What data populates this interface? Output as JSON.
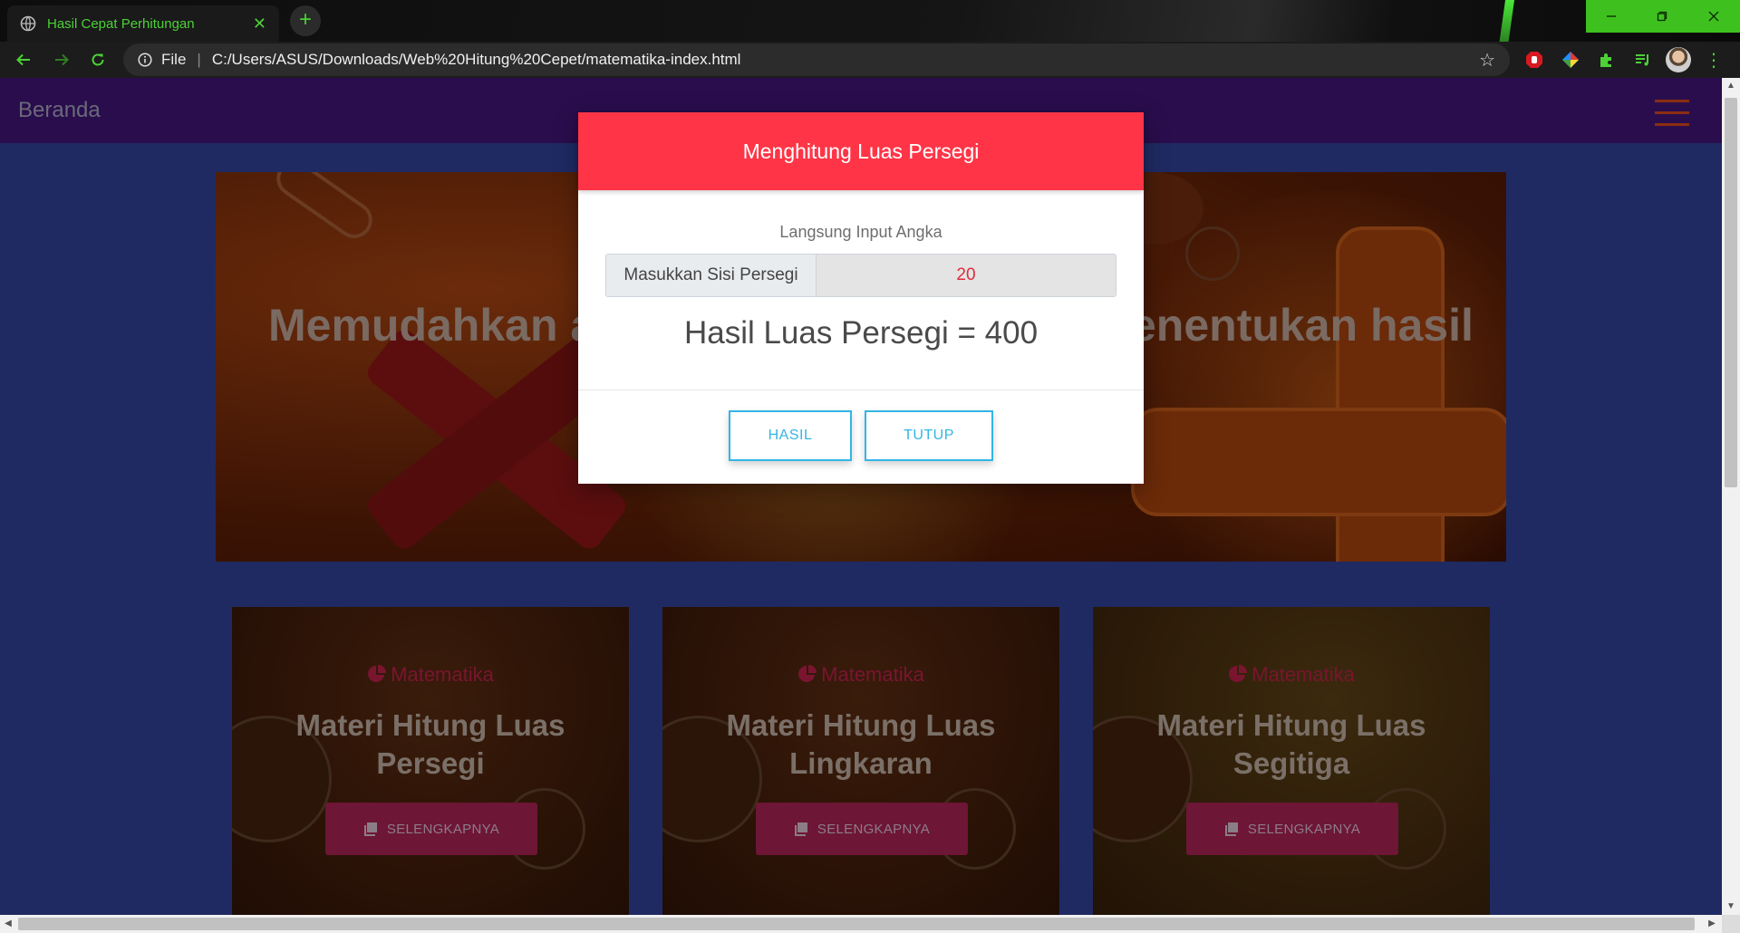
{
  "browser": {
    "tab_title": "Hasil Cepat Perhitungan",
    "tab_close": "✕",
    "new_tab": "+",
    "address": {
      "scheme": "File",
      "separator": "|",
      "url": "C:/Users/ASUS/Downloads/Web%20Hitung%20Cepet/matematika-index.html"
    },
    "accent_color": "#4cd137"
  },
  "navbar": {
    "brand": "Beranda"
  },
  "hero": {
    "text_left": "Memudahkan a",
    "text_right": "enentukan hasil"
  },
  "cards": [
    {
      "category": "Matematika",
      "title_line1": "Materi Hitung Luas",
      "title_line2": "Persegi",
      "button": "SELENGKAPNYA"
    },
    {
      "category": "Matematika",
      "title_line1": "Materi Hitung Luas",
      "title_line2": "Lingkaran",
      "button": "SELENGKAPNYA"
    },
    {
      "category": "Matematika",
      "title_line1": "Materi Hitung Luas",
      "title_line2": "Segitiga",
      "button": "SELENGKAPNYA"
    }
  ],
  "modal": {
    "title": "Menghitung Luas Persegi",
    "hint": "Langsung Input Angka",
    "input_prefix": "Masukkan Sisi Persegi",
    "input_value": "20",
    "result": "Hasil Luas Persegi = 400",
    "btn_hasil": "HASIL",
    "btn_tutup": "TUTUP",
    "header_color": "#ff3547",
    "button_color": "#33b5e5"
  }
}
